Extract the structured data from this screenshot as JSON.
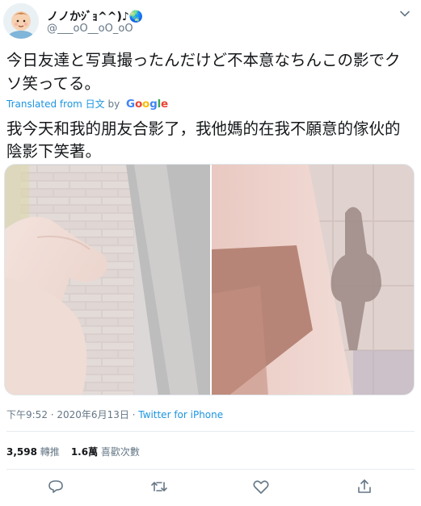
{
  "tweet": {
    "display_name": "ノノかｼﾞｮ^^)♪🌏",
    "handle": "@___oO__oO_oO",
    "text_original": "今日友達と写真撮ったんだけど不本意なちんこの影でクソ笑ってる。",
    "translated_prefix": "Translated from 日文",
    "translated_by": "by",
    "translator": "Google",
    "text_translated": "我今天和我的朋友合影了，我他媽的在我不願意的傢伙的陰影下笑著。",
    "time": "下午9:52 · 2020年6月13日 · ",
    "source": "Twitter for iPhone",
    "retweets_count": "3,598",
    "retweets_label": "轉推",
    "likes_count": "1.6萬",
    "likes_label": "喜歡次數"
  },
  "icons": {
    "avatar": "baby-avatar-icon",
    "caret": "chevron-down-icon",
    "reply": "reply-icon",
    "retweet": "retweet-icon",
    "like": "heart-icon",
    "share": "share-icon"
  },
  "colors": {
    "link": "#1b95e0",
    "secondary": "#657786",
    "text": "#14171a",
    "divider": "#e6ecf0"
  }
}
